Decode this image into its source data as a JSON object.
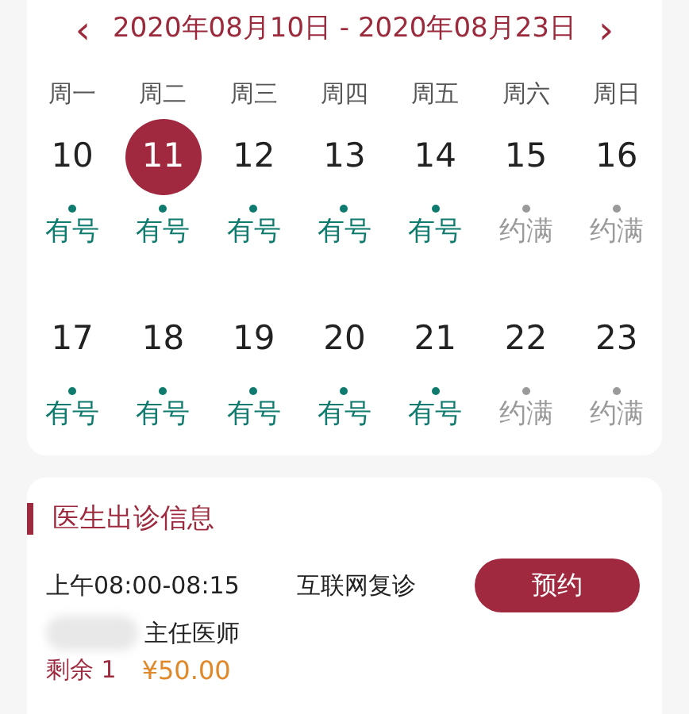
{
  "range": {
    "prev": "‹",
    "title": "2020年08月10日 - 2020年08月23日",
    "next": "›"
  },
  "weekdays": [
    "周一",
    "周二",
    "周三",
    "周四",
    "周五",
    "周六",
    "周日"
  ],
  "weeks": [
    [
      {
        "date": "10",
        "kind": "available",
        "label": "有号",
        "selected": false
      },
      {
        "date": "11",
        "kind": "available",
        "label": "有号",
        "selected": true
      },
      {
        "date": "12",
        "kind": "available",
        "label": "有号",
        "selected": false
      },
      {
        "date": "13",
        "kind": "available",
        "label": "有号",
        "selected": false
      },
      {
        "date": "14",
        "kind": "available",
        "label": "有号",
        "selected": false
      },
      {
        "date": "15",
        "kind": "full",
        "label": "约满",
        "selected": false
      },
      {
        "date": "16",
        "kind": "full",
        "label": "约满",
        "selected": false
      }
    ],
    [
      {
        "date": "17",
        "kind": "available",
        "label": "有号",
        "selected": false
      },
      {
        "date": "18",
        "kind": "available",
        "label": "有号",
        "selected": false
      },
      {
        "date": "19",
        "kind": "available",
        "label": "有号",
        "selected": false
      },
      {
        "date": "20",
        "kind": "available",
        "label": "有号",
        "selected": false
      },
      {
        "date": "21",
        "kind": "available",
        "label": "有号",
        "selected": false
      },
      {
        "date": "22",
        "kind": "full",
        "label": "约满",
        "selected": false
      },
      {
        "date": "23",
        "kind": "full",
        "label": "约满",
        "selected": false
      }
    ]
  ],
  "schedule": {
    "title": "医生出诊信息",
    "slots": [
      {
        "time": "上午08:00-08:15",
        "type": "互联网复诊",
        "button": "预约",
        "doctor_title": "主任医师",
        "remaining": "剩余 1",
        "price": "¥50.00"
      }
    ]
  }
}
